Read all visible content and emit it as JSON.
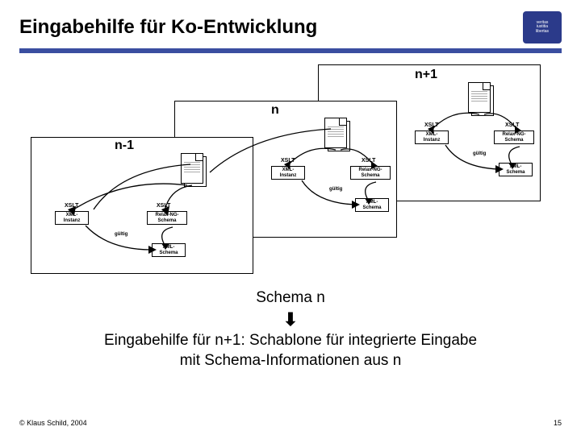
{
  "title": "Eingabehilfe für Ko-Entwicklung",
  "logo": {
    "line1": "veritas",
    "line2": "iustitia",
    "line3": "libertas"
  },
  "stages": {
    "np1": "n+1",
    "n": "n",
    "nm1": "n-1"
  },
  "labels": {
    "xslt": "XSLT",
    "xmlInstanz": "XML-\nInstanz",
    "relaxNG": "Relax-NG-\nSchema",
    "xmlSchema": "XML-\nSchema",
    "gultig": "gültig"
  },
  "body": {
    "line1": "Schema n",
    "arrow": "⬇",
    "line2a": "Eingabehilfe für n+1: Schablone für integrierte Eingabe",
    "line2b": "mit Schema-Informationen aus n"
  },
  "footer": {
    "copyright": "© Klaus Schild, 2004",
    "page": "15"
  }
}
